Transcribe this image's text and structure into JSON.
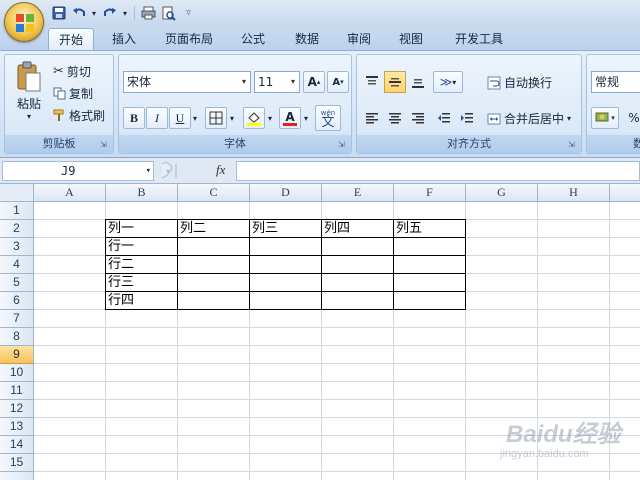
{
  "quick_access": {
    "icons": [
      "save-icon",
      "undo-icon",
      "redo-icon",
      "print-preview-icon",
      "customize-icon"
    ]
  },
  "tabs": [
    {
      "label": "开始",
      "active": true
    },
    {
      "label": "插入",
      "active": false
    },
    {
      "label": "页面布局",
      "active": false
    },
    {
      "label": "公式",
      "active": false
    },
    {
      "label": "数据",
      "active": false
    },
    {
      "label": "审阅",
      "active": false
    },
    {
      "label": "视图",
      "active": false
    },
    {
      "label": "开发工具",
      "active": false
    }
  ],
  "clipboard": {
    "paste_label": "粘贴",
    "cut_label": "剪切",
    "copy_label": "复制",
    "format_painter_label": "格式刷",
    "group_label": "剪贴板"
  },
  "font": {
    "font_name": "宋体",
    "font_size": "11",
    "bold": "B",
    "italic": "I",
    "underline": "U",
    "font_color_glyph": "A",
    "phonetic_glyph": "文",
    "phonetic_small": "wén",
    "group_label": "字体"
  },
  "alignment": {
    "wrap_text_label": "自动换行",
    "merge_center_label": "合并后居中",
    "group_label": "对齐方式"
  },
  "number": {
    "format_value": "常规",
    "group_label_partial": "数",
    "percent_glyph": "%"
  },
  "formula_bar": {
    "name_box": "J9",
    "fx_label": "fx",
    "formula_value": ""
  },
  "sheet": {
    "columns": [
      "A",
      "B",
      "C",
      "D",
      "E",
      "F",
      "G",
      "H"
    ],
    "rows": [
      "1",
      "2",
      "3",
      "4",
      "5",
      "6",
      "7",
      "8",
      "9",
      "10",
      "11",
      "12",
      "13",
      "14",
      "15"
    ],
    "selected_row": "9",
    "table_header": [
      "列一",
      "列二",
      "列三",
      "列四",
      "列五"
    ],
    "table_rows": [
      "行一",
      "行二",
      "行三",
      "行四"
    ]
  },
  "watermark": {
    "text1": "Baidu经验",
    "text2": "jingyan.baidu.com"
  },
  "colors": {
    "ribbon_blue": "#d6e5f6",
    "selection_orange": "#f7c25a",
    "grid_line": "#d0d7e5"
  }
}
